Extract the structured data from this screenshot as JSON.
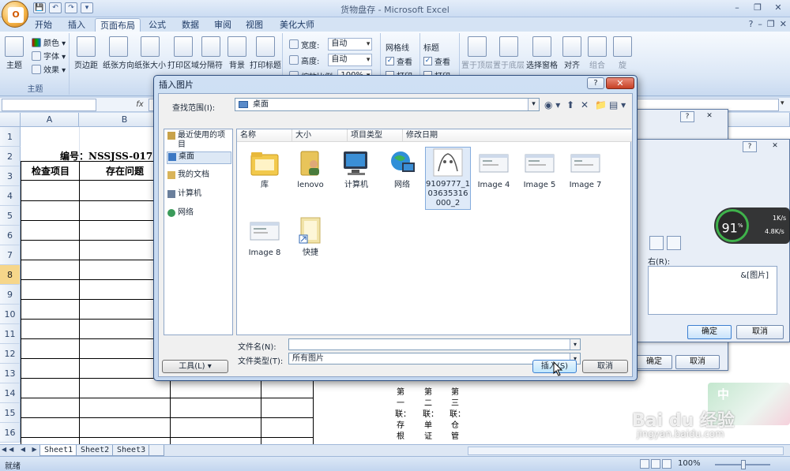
{
  "window": {
    "title": "货物盘存 - Microsoft Excel",
    "office_button": "O",
    "qat": [
      "💾",
      "↶",
      "↷",
      "▾"
    ],
    "controls": [
      "–",
      "❐",
      "✕"
    ],
    "help_controls": [
      "?",
      "–",
      "❐",
      "✕"
    ]
  },
  "tabs": [
    "开始",
    "插入",
    "页面布局",
    "公式",
    "数据",
    "审阅",
    "视图",
    "美化大师"
  ],
  "active_tab": "页面布局",
  "ribbon": {
    "themes": {
      "label": "主题",
      "btn": "主题",
      "colors": "颜色 ▾",
      "fonts": "字体 ▾",
      "effects": "效果 ▾"
    },
    "page_setup": [
      "页边距",
      "纸张方向",
      "纸张大小",
      "打印区域",
      "分隔符",
      "背景",
      "打印标题"
    ],
    "scale": {
      "width_label": "宽度:",
      "width_value": "自动",
      "height_label": "高度:",
      "height_value": "自动",
      "scale_label": "缩放比例:",
      "scale_value": "100%"
    },
    "gridlines": {
      "title": "网格线",
      "view": "查看",
      "print": "打印",
      "view_checked": "✓"
    },
    "headings": {
      "title": "标题",
      "view": "查看",
      "print": "打印",
      "view_checked": "✓"
    },
    "arrange": [
      "置于顶层",
      "置于底层",
      "选择窗格",
      "对齐",
      "组合",
      "旋"
    ]
  },
  "formula_bar": {
    "name_box": "",
    "fx": "fx",
    "value": ""
  },
  "sheet": {
    "columns": [
      "A",
      "B"
    ],
    "rows": [
      "1",
      "2",
      "3",
      "4",
      "5",
      "6",
      "7",
      "8",
      "9",
      "10",
      "11",
      "12",
      "13",
      "14",
      "15",
      "16"
    ],
    "selected_row": "8",
    "code_text": "编号：NSSJSS-017",
    "header_a": "检查项目",
    "header_b": "存在问题",
    "vertical_notes": [
      "第一联：存根",
      "第二联：单证",
      "第三联：仓管"
    ]
  },
  "sheet_tabs": [
    "Sheet1",
    "Sheet2",
    "Sheet3"
  ],
  "sheet_nav": "◀◀ ◀ ▶ ▶▶",
  "status": {
    "ready": "就绪",
    "zoom": "100%"
  },
  "bg_dialog_back": {
    "help": "?",
    "close": "✕",
    "ok": "确定",
    "cancel": "取消"
  },
  "bg_dialog_front": {
    "help": "?",
    "close": "✕",
    "right_label": "右(R):",
    "right_value": "&[图片]",
    "ok": "确定",
    "cancel": "取消"
  },
  "dialog": {
    "title": "插入图片",
    "help": "?",
    "close": "✕",
    "look_in_label": "查找范围(I):",
    "look_in_value": "桌面",
    "toolbar": [
      "◉ ▾",
      "⬆",
      "✕",
      "📁",
      "▤ ▾"
    ],
    "places": [
      "最近使用的项目",
      "桌面",
      "我的文档",
      "计算机",
      "网络"
    ],
    "selected_place": "桌面",
    "columns": [
      "名称",
      "大小",
      "项目类型",
      "修改日期"
    ],
    "files": [
      {
        "name": "库",
        "icon": "library-folder"
      },
      {
        "name": "lenovo",
        "icon": "user-folder"
      },
      {
        "name": "计算机",
        "icon": "computer"
      },
      {
        "name": "网络",
        "icon": "network"
      },
      {
        "name": "9109777_103635316000_2",
        "icon": "image-thumbnail"
      },
      {
        "name": "Image 4",
        "icon": "image-thumbnail"
      },
      {
        "name": "Image 5",
        "icon": "image-thumbnail"
      },
      {
        "name": "Image 7",
        "icon": "image-thumbnail"
      },
      {
        "name": "Image 8",
        "icon": "image-thumbnail"
      },
      {
        "name": "快捷",
        "icon": "shortcut-folder"
      }
    ],
    "selected_file": "9109777_103635316000_2",
    "filename_label": "文件名(N):",
    "filename_value": "",
    "filetype_label": "文件类型(T):",
    "filetype_value": "所有图片",
    "tools": "工具(L)",
    "insert": "插入(S)",
    "cancel": "取消"
  },
  "net_widget": {
    "percent": "91",
    "unit": "%",
    "up": "1K/s",
    "down": "4.8K/s"
  },
  "watermark": {
    "zh": "中",
    "brand": "Bai du 经验",
    "url": "jingyan.baidu.com"
  },
  "colors": {
    "accent": "#3c7fd1",
    "ribbon": "#dbe7f6",
    "close_red": "#c63f24",
    "selected_row": "#f6d68a"
  }
}
